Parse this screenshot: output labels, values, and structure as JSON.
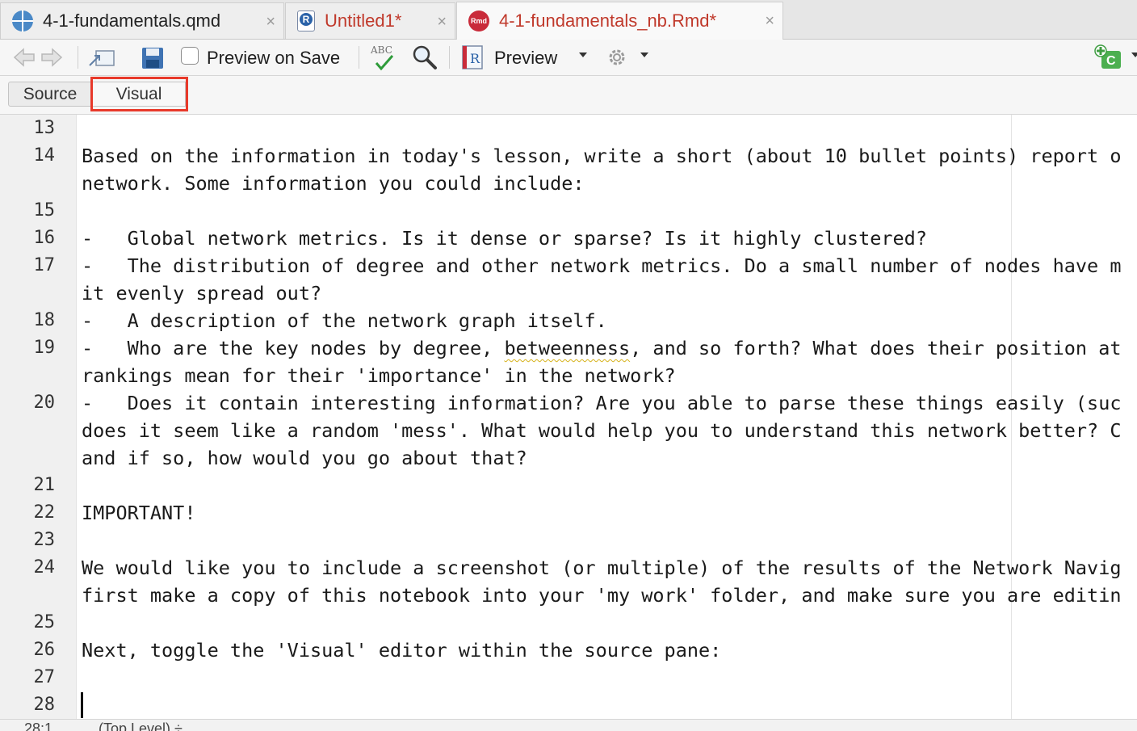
{
  "tabs": [
    {
      "label": "4-1-fundamentals.qmd",
      "icon": "quarto-icon",
      "modified": false,
      "active": false
    },
    {
      "label": "Untitled1*",
      "icon": "r-script-icon",
      "modified": true,
      "active": false
    },
    {
      "label": "4-1-fundamentals_nb.Rmd*",
      "icon": "rmarkdown-icon",
      "modified": true,
      "active": true
    }
  ],
  "tab_close_glyph": "×",
  "toolbar": {
    "preview_on_save_label": "Preview on Save",
    "preview_label": "Preview",
    "spellcheck_glyph": "ABC",
    "r_notebook_glyph": "R",
    "insert_chunk_glyph": "C"
  },
  "mode_bar": {
    "source_label": "Source",
    "visual_label": "Visual",
    "highlight_color": "#e8392a"
  },
  "editor": {
    "line_numbers": [
      "13",
      "14",
      "",
      "15",
      "16",
      "17",
      "",
      "18",
      "19",
      "",
      "20",
      "",
      "",
      "21",
      "22",
      "23",
      "24",
      "",
      "25",
      "26",
      "27",
      "28"
    ],
    "lines": [
      "",
      "Based on the information in today's lesson, write a short (about 10 bullet points) report o",
      "network. Some information you could include:",
      "",
      "-   Global network metrics. Is it dense or sparse? Is it highly clustered?",
      "-   The distribution of degree and other network metrics. Do a small number of nodes have m",
      "it evenly spread out?",
      "-   A description of the network graph itself.",
      "-   Who are the key nodes by degree, betweenness, and so forth? What does their position at",
      "rankings mean for their 'importance' in the network?",
      "-   Does it contain interesting information? Are you able to parse these things easily (suc",
      "does it seem like a random 'mess'. What would help you to understand this network better? C",
      "and if so, how would you go about that?",
      "",
      "IMPORTANT!",
      "",
      "We would like you to include a screenshot (or multiple) of the results of the Network Navig",
      "first make a copy of this notebook into your 'my work' folder, and make sure you are editin",
      "",
      "Next, toggle the 'Visual' editor within the source pane:",
      "",
      ""
    ],
    "misspelled_word": "betweenness",
    "cursor_line": "28"
  },
  "status": {
    "position": "28:1",
    "context": "(Top Level) ÷"
  },
  "colors": {
    "modified_tab": "#c0392b",
    "spellcheck_check": "#2e9b3a",
    "insert_chunk_green": "#4caf50"
  }
}
